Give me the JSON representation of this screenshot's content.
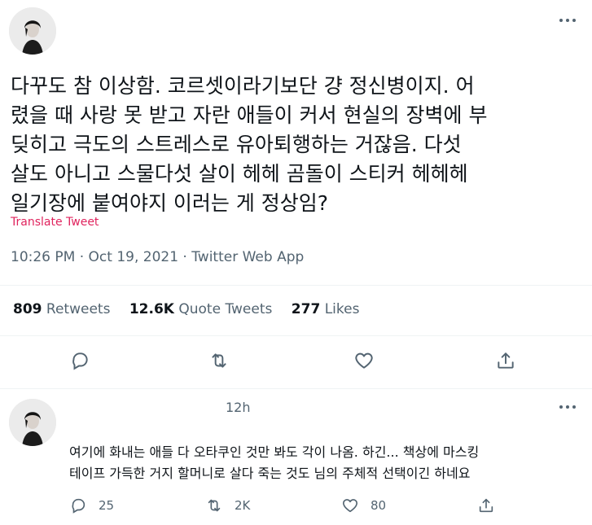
{
  "main_tweet": {
    "text_lines": [
      "다꾸도 참 이상함. 코르셋이라기보단 걍 정신병이지. 어",
      "렸을 때 사랑 못 받고 자란 애들이 커서 현실의 장벽에 부",
      "딪히고 극도의 스트레스로 유아퇴행하는 거잖음. 다섯",
      "살도 아니고 스물다섯 살이 헤헤 곰돌이 스티커 헤헤헤",
      "일기장에 붙여야지 이러는 게 정상임?"
    ],
    "translate_label": "Translate Tweet",
    "timestamp": "10:26 PM · Oct 19, 2021 · Twitter Web App",
    "stats": {
      "retweets_count": "809",
      "retweets_label": "Retweets",
      "quote_count": "12.6K",
      "quote_label": "Quote Tweets",
      "likes_count": "277",
      "likes_label": "Likes"
    }
  },
  "reply": {
    "time": "12h",
    "text_lines": [
      "여기에 화내는 애들 다 오타쿠인 것만 봐도 각이 나옴. 하긴... 책상에 마스킹",
      "테이프 가득한 거지 할머니로 살다 죽는 것도 님의 주체적 선택이긴 하네요"
    ],
    "reply_count": "25",
    "retweet_count": "2K",
    "like_count": "80"
  },
  "icons": {
    "more": "more-icon",
    "reply": "reply-icon",
    "retweet": "retweet-icon",
    "like": "heart-icon",
    "share": "share-icon"
  },
  "colors": {
    "text": "#0f1419",
    "secondary": "#536471",
    "translate": "#e0245e",
    "divider": "#eff3f4"
  }
}
